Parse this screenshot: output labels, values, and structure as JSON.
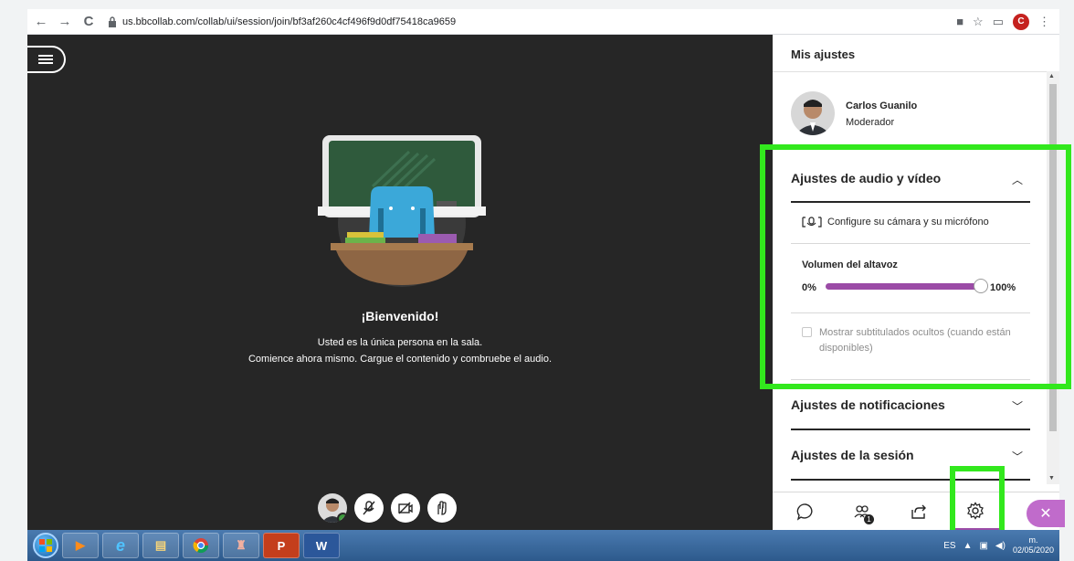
{
  "browser": {
    "url": "us.bbcollab.com/collab/ui/session/join/bf3af260c4cf496f9d0df75418ca9659",
    "profile_initial": "C"
  },
  "stage": {
    "welcome_title": "¡Bienvenido!",
    "welcome_line1": "Usted es la única persona en la sala.",
    "welcome_line2": "Comience ahora mismo. Cargue el contenido y combruebe el audio."
  },
  "panel": {
    "title": "Mis ajustes",
    "user": {
      "name": "Carlos Guanilo",
      "role": "Moderador"
    },
    "audio_video": {
      "heading": "Ajustes de audio y vídeo",
      "expanded": true,
      "setup_link": "Configure su cámara y su micrófono",
      "volume_label": "Volumen del altavoz",
      "volume_min": "0%",
      "volume_max": "100%",
      "volume_value": 1.0,
      "captions_label": "Mostrar subtitulados ocultos (cuando están disponibles)",
      "captions_checked": false
    },
    "notifications": {
      "heading": "Ajustes de notificaciones"
    },
    "session": {
      "heading": "Ajustes de la sesión"
    },
    "tabs": {
      "attendees_badge": "1"
    }
  },
  "taskbar": {
    "word_label": "W",
    "ppt_label": "P",
    "lang": "ES",
    "time": "m.",
    "date": "02/05/2020"
  },
  "colors": {
    "accent": "#9b4ba6",
    "highlight": "#32e81d",
    "stage_bg": "#262626"
  }
}
